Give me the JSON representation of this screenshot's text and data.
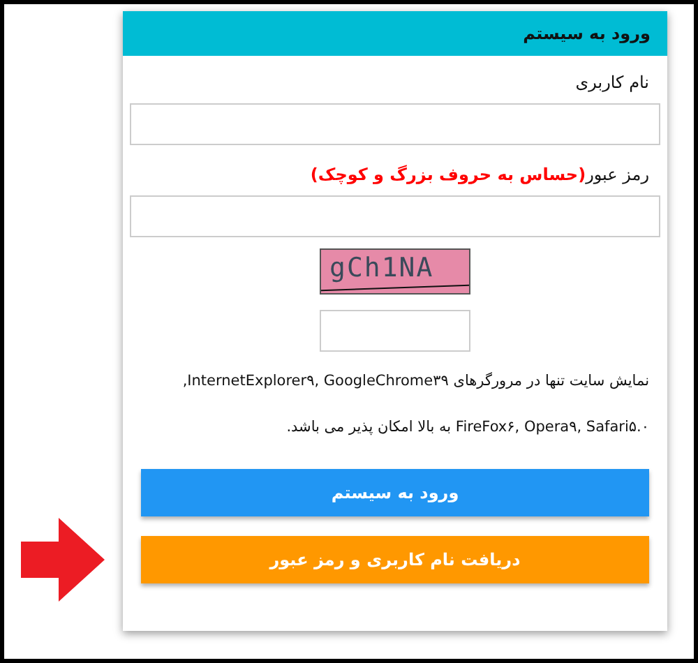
{
  "panel": {
    "title": "ورود به سیستم"
  },
  "username": {
    "label": "نام کاربری"
  },
  "password": {
    "label": "رمز عبور",
    "note": "(حساس به حروف بزرگ و کوچک)"
  },
  "captcha": {
    "text": "gCh1NA"
  },
  "notice_lines": [
    "نمایش سایت تنها در مرورگرهای InternetExplorer۹, GoogleChrome۳۹,",
    "FireFox۶, Opera۹, Safari۵.۰ به بالا امکان پذیر می باشد."
  ],
  "buttons": [
    {
      "label": "ورود به سیستم",
      "kind": "primary"
    },
    {
      "label": "دریافت نام کاربری و رمز عبور",
      "kind": "secondary",
      "pointed": true
    }
  ]
}
